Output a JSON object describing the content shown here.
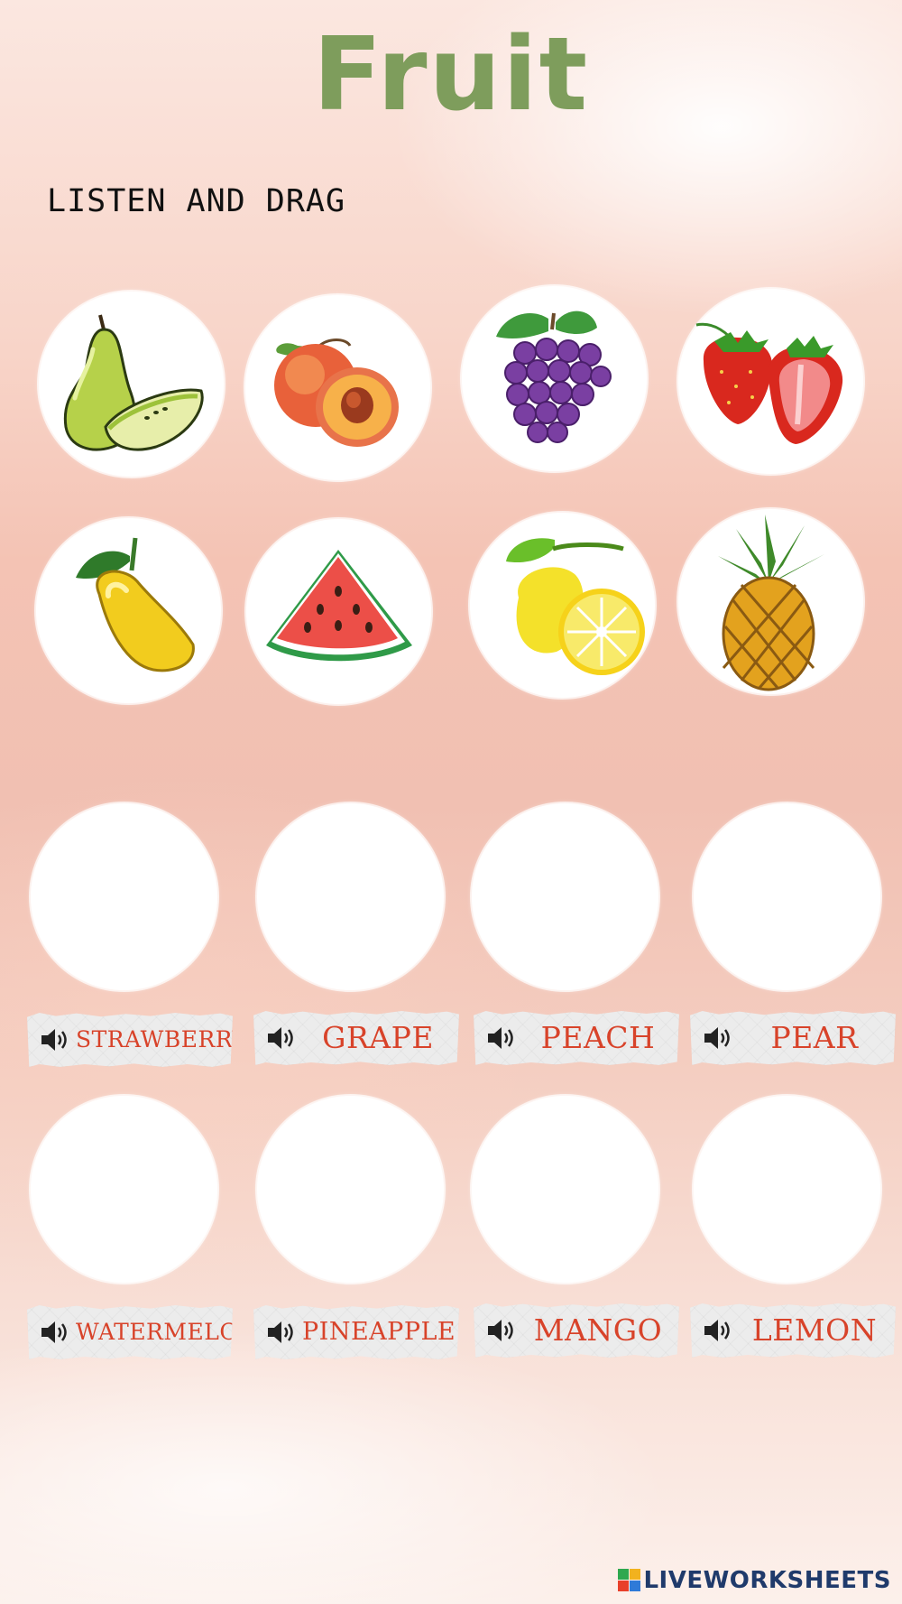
{
  "title": "Fruit",
  "instruction": "LISTEN AND DRAG",
  "fruit_cards": [
    {
      "icon": "pear-icon"
    },
    {
      "icon": "peach-icon"
    },
    {
      "icon": "grapes-icon"
    },
    {
      "icon": "strawberry-icon"
    },
    {
      "icon": "mango-icon"
    },
    {
      "icon": "watermelon-icon"
    },
    {
      "icon": "lemon-icon"
    },
    {
      "icon": "pineapple-icon"
    }
  ],
  "labels": [
    {
      "text": "STRAWBERRY",
      "icon": "speaker-icon"
    },
    {
      "text": "GRAPE",
      "icon": "speaker-icon"
    },
    {
      "text": "PEACH",
      "icon": "speaker-icon"
    },
    {
      "text": "PEAR",
      "icon": "speaker-icon"
    },
    {
      "text": "WATERMELON",
      "icon": "speaker-icon"
    },
    {
      "text": "PINEAPPLE",
      "icon": "speaker-icon"
    },
    {
      "text": "MANGO",
      "icon": "speaker-icon"
    },
    {
      "text": "LEMON",
      "icon": "speaker-icon"
    }
  ],
  "brand": {
    "name": "LIVEWORKSHEETS",
    "logo_letters": "LIVE"
  },
  "colors": {
    "title": "#7e9d5c",
    "label_text": "#d8432a",
    "brand": "#1f3a6b"
  }
}
